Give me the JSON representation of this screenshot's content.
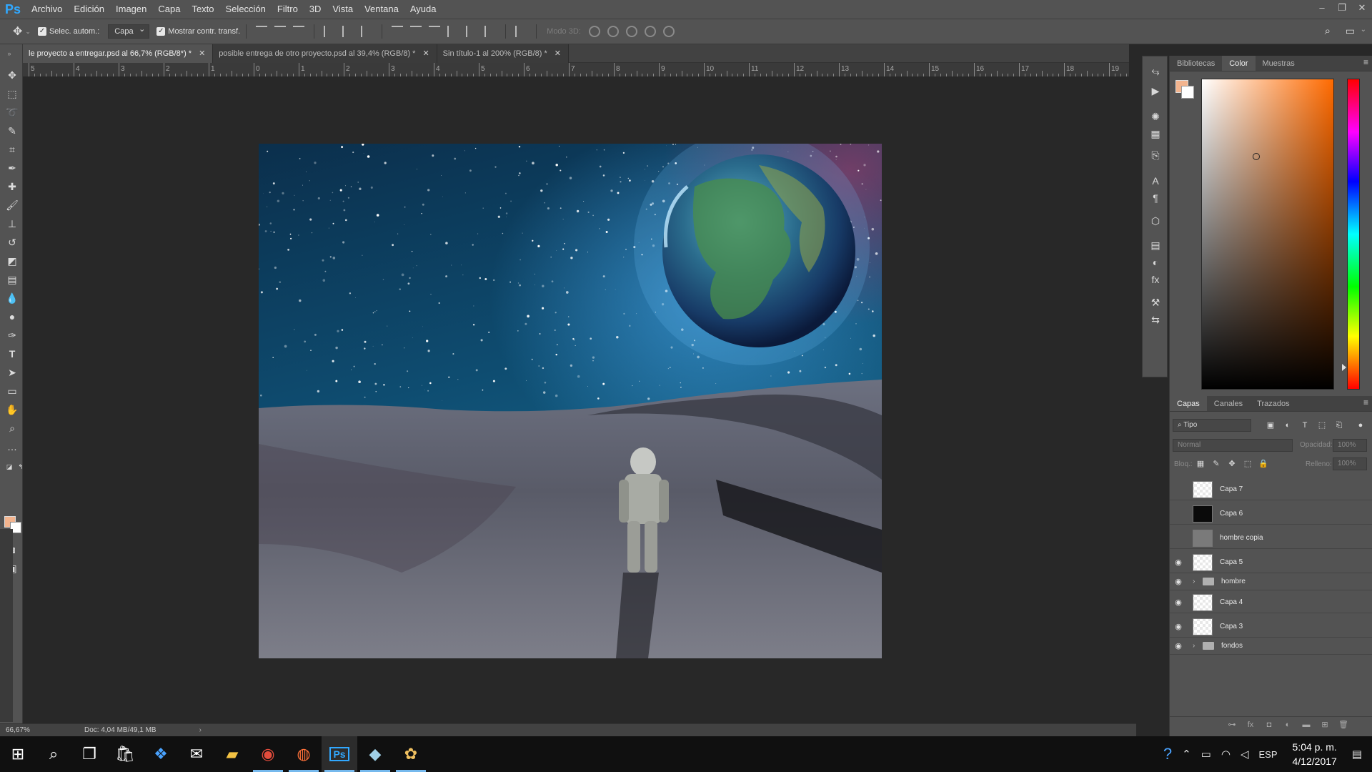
{
  "app": {
    "logo": "Ps"
  },
  "menu": [
    "Archivo",
    "Edición",
    "Imagen",
    "Capa",
    "Texto",
    "Selección",
    "Filtro",
    "3D",
    "Vista",
    "Ventana",
    "Ayuda"
  ],
  "options": {
    "auto_select_label": "Selec. autom.:",
    "auto_select_value": "Capa",
    "show_transform_label": "Mostrar contr. transf.",
    "mode3d_label": "Modo 3D:"
  },
  "tabs": [
    {
      "label": "le proyecto a entregar.psd al 66,7% (RGB/8*) *",
      "active": true
    },
    {
      "label": "posible entrega de otro proyecto.psd al 39,4% (RGB/8) *",
      "active": false
    },
    {
      "label": "Sin título-1 al 200% (RGB/8) *",
      "active": false
    }
  ],
  "ruler_numbers": [
    "5",
    "4",
    "3",
    "2",
    "1",
    "0",
    "1",
    "2",
    "3",
    "4",
    "5",
    "6",
    "7",
    "8",
    "9",
    "10",
    "11",
    "12",
    "13",
    "14",
    "15",
    "16",
    "17",
    "18",
    "19"
  ],
  "status": {
    "zoom": "66,67%",
    "doc": "Doc: 4,04 MB/49,1 MB"
  },
  "right_panel": {
    "top_tabs": [
      "Bibliotecas",
      "Color",
      "Muestras"
    ],
    "active_top_tab": "Color",
    "layers_tabs": [
      "Capas",
      "Canales",
      "Trazados"
    ],
    "filter_kind": "Tipo",
    "blend_mode": "Normal",
    "opacity_label": "Opacidad:",
    "opacity_value": "100%",
    "lock_label": "Bloq.:",
    "fill_label": "Relleno:",
    "fill_value": "100%"
  },
  "colors": {
    "foreground": "#f3b48e",
    "background": "#ffffff"
  },
  "layers": [
    {
      "name": "Capa 7",
      "visible": false,
      "thumb": "transparent",
      "type": "layer"
    },
    {
      "name": "Capa 6",
      "visible": false,
      "thumb": "black",
      "type": "layer"
    },
    {
      "name": "hombre copia",
      "visible": false,
      "thumb": "gray",
      "type": "layer"
    },
    {
      "name": "Capa 5",
      "visible": true,
      "thumb": "transparent",
      "type": "layer"
    },
    {
      "name": "hombre",
      "visible": true,
      "thumb": "folder",
      "type": "group"
    },
    {
      "name": "Capa 4",
      "visible": true,
      "thumb": "transparent",
      "type": "layer"
    },
    {
      "name": "Capa 3",
      "visible": true,
      "thumb": "transparent",
      "type": "layer"
    },
    {
      "name": "fondos",
      "visible": true,
      "thumb": "folder",
      "type": "group"
    }
  ],
  "taskbar": {
    "clock_time": "5:04 p. m.",
    "clock_date": "4/12/2017",
    "language": "ESP"
  }
}
